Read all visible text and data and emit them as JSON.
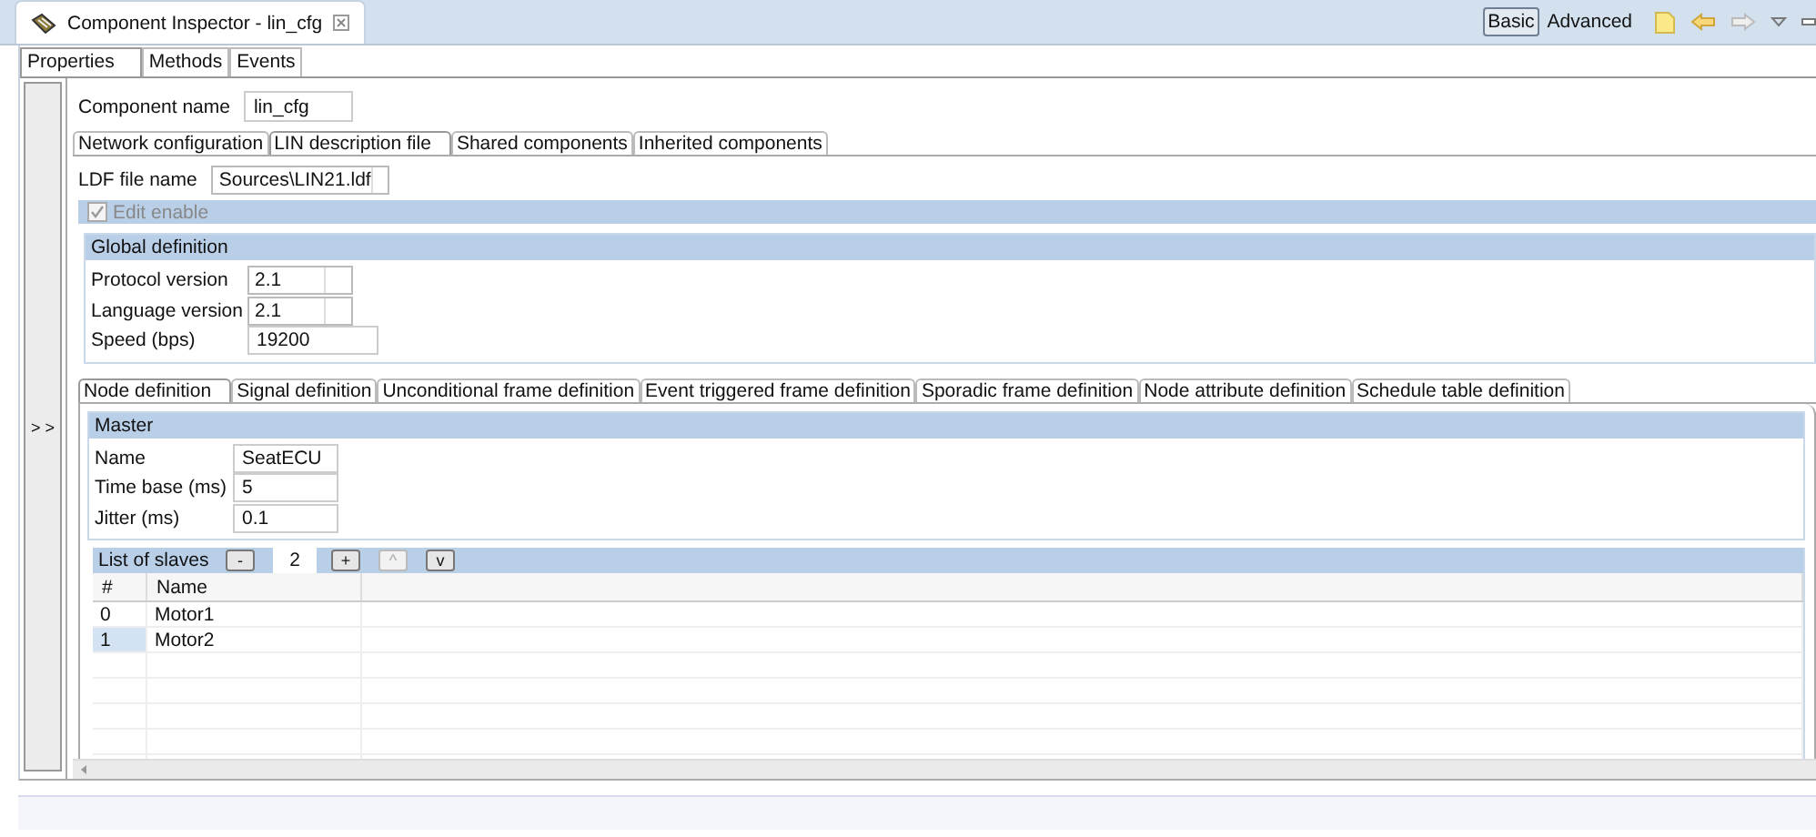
{
  "view_tab": {
    "title": "Component Inspector - lin_cfg"
  },
  "mode_buttons": [
    {
      "label": "Basic",
      "selected": true
    },
    {
      "label": "Advanced",
      "selected": false
    }
  ],
  "property_tabs": [
    {
      "label": "Properties",
      "selected": true
    },
    {
      "label": "Methods",
      "selected": false
    },
    {
      "label": "Events",
      "selected": false
    }
  ],
  "collapse_button": "> >",
  "component_name": {
    "label": "Component name",
    "value": "lin_cfg"
  },
  "section_tabs": [
    {
      "label": "Network configuration",
      "selected": false
    },
    {
      "label": "LIN description file",
      "selected": true
    },
    {
      "label": "Shared components",
      "selected": false
    },
    {
      "label": "Inherited components",
      "selected": false
    }
  ],
  "ldf_file": {
    "label": "LDF file name",
    "value": "Sources\\LIN21.ldf"
  },
  "edit_enable": {
    "label": "Edit enable",
    "checked": true,
    "disabled": true
  },
  "global_definition": {
    "title": "Global definition",
    "fields": [
      {
        "label": "Protocol version",
        "value": "2.1",
        "kind": "combo"
      },
      {
        "label": "Language version",
        "value": "2.1",
        "kind": "combo"
      },
      {
        "label": "Speed (bps)",
        "value": "19200",
        "kind": "text"
      }
    ]
  },
  "definition_tabs": [
    {
      "label": "Node definition",
      "selected": true
    },
    {
      "label": "Signal definition",
      "selected": false
    },
    {
      "label": "Unconditional frame definition",
      "selected": false
    },
    {
      "label": "Event triggered frame definition",
      "selected": false
    },
    {
      "label": "Sporadic frame definition",
      "selected": false
    },
    {
      "label": "Node attribute definition",
      "selected": false
    },
    {
      "label": "Schedule table definition",
      "selected": false
    }
  ],
  "master": {
    "title": "Master",
    "fields": [
      {
        "label": "Name",
        "value": "SeatECU",
        "kind": "text"
      },
      {
        "label": "Time base (ms)",
        "value": "5",
        "kind": "text"
      },
      {
        "label": "Jitter (ms)",
        "value": "0.1",
        "kind": "text"
      }
    ]
  },
  "slaves": {
    "title": "List of slaves",
    "controls": [
      {
        "kind": "button",
        "label": "-",
        "disabled": false
      },
      {
        "kind": "field",
        "value": "2"
      },
      {
        "kind": "button",
        "label": "+",
        "disabled": false
      },
      {
        "kind": "button",
        "label": "^",
        "disabled": true
      },
      {
        "kind": "button",
        "label": "v",
        "disabled": false
      }
    ],
    "columns": [
      "#",
      "Name"
    ],
    "rows": [
      {
        "index": "0",
        "name": "Motor1",
        "selected": false
      },
      {
        "index": "1",
        "name": "Motor2",
        "selected": true
      }
    ]
  }
}
